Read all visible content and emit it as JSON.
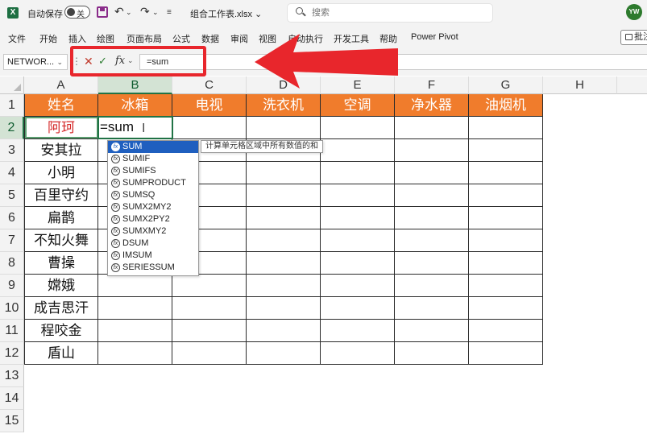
{
  "titlebar": {
    "app_logo": "X",
    "autosave_label": "自动保存",
    "autosave_state": "关",
    "filename": "组合工作表.xlsx",
    "search_placeholder": "搜索",
    "avatar_initials": "YW",
    "icons": [
      "excel-logo-icon",
      "save-icon",
      "undo-icon",
      "redo-icon",
      "customize-qat-icon",
      "search-icon"
    ]
  },
  "ribbon": {
    "tabs": [
      "文件",
      "开始",
      "插入",
      "绘图",
      "页面布局",
      "公式",
      "数据",
      "审阅",
      "视图",
      "自动执行",
      "开发工具",
      "帮助",
      "Power Pivot"
    ],
    "comment_label": "批注"
  },
  "formula_bar": {
    "name_box": "NETWOR...",
    "fx_label": "fx",
    "formula": "=sum"
  },
  "sheet": {
    "columns": [
      "A",
      "B",
      "C",
      "D",
      "E",
      "F",
      "G",
      "H"
    ],
    "rows": [
      "1",
      "2",
      "3",
      "4",
      "5",
      "6",
      "7",
      "8",
      "9",
      "10",
      "11",
      "12",
      "13",
      "14",
      "15"
    ],
    "header_row": [
      "姓名",
      "冰箱",
      "电视",
      "洗衣机",
      "空调",
      "净水器",
      "油烟机"
    ],
    "names": [
      "阿珂",
      "安其拉",
      "小明",
      "百里守约",
      "扁鹊",
      "不知火舞",
      "曹操",
      "嫦娥",
      "成吉思汗",
      "程咬金",
      "盾山"
    ],
    "editing_text": "=sum",
    "selected_column": "B",
    "selected_row": "2",
    "header_color": "#f07c2c",
    "highlight_name_color": "#d52a2a"
  },
  "autocomplete": {
    "items": [
      "SUM",
      "SUMIF",
      "SUMIFS",
      "SUMPRODUCT",
      "SUMSQ",
      "SUMX2MY2",
      "SUMX2PY2",
      "SUMXMY2",
      "DSUM",
      "IMSUM",
      "SERIESSUM"
    ],
    "selected_index": 0,
    "tooltip": "计算单元格区域中所有数值的和"
  },
  "annotation": {
    "color": "#e8262c"
  }
}
